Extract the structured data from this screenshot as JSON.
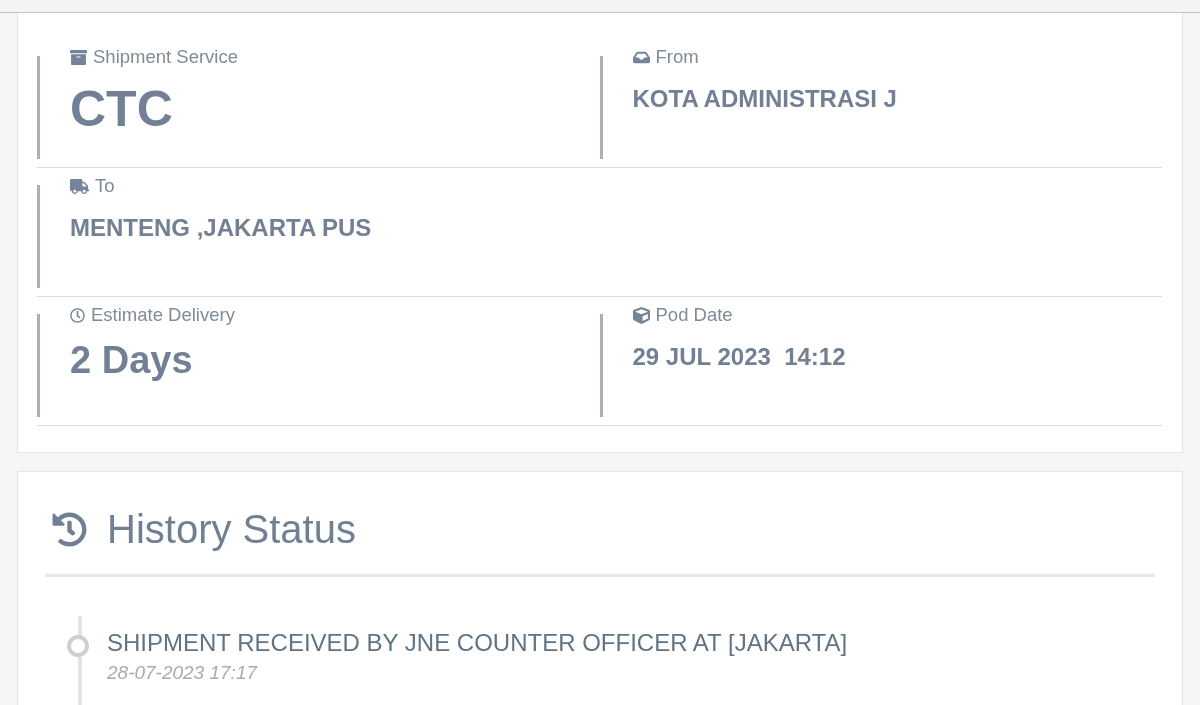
{
  "details": {
    "rows": [
      {
        "fields": [
          {
            "kind": "service",
            "label": "Shipment Service",
            "value": "CTC"
          },
          {
            "kind": "origin",
            "label": "From",
            "value": "KOTA ADMINISTRASI J"
          }
        ]
      },
      {
        "fields": [
          {
            "kind": "destination",
            "label": "To",
            "value": "MENTENG ,JAKARTA PUS"
          }
        ]
      },
      {
        "fields": [
          {
            "kind": "estimate",
            "label": "Estimate Delivery",
            "value": "2 Days"
          },
          {
            "kind": "pod",
            "label": "Pod Date",
            "value": "29 JUL 2023  14:12"
          }
        ]
      }
    ]
  },
  "history": {
    "title": "History Status",
    "events": [
      {
        "status": "SHIPMENT RECEIVED BY JNE COUNTER OFFICER AT [JAKARTA]",
        "time": "28-07-2023 17:17"
      }
    ]
  }
}
